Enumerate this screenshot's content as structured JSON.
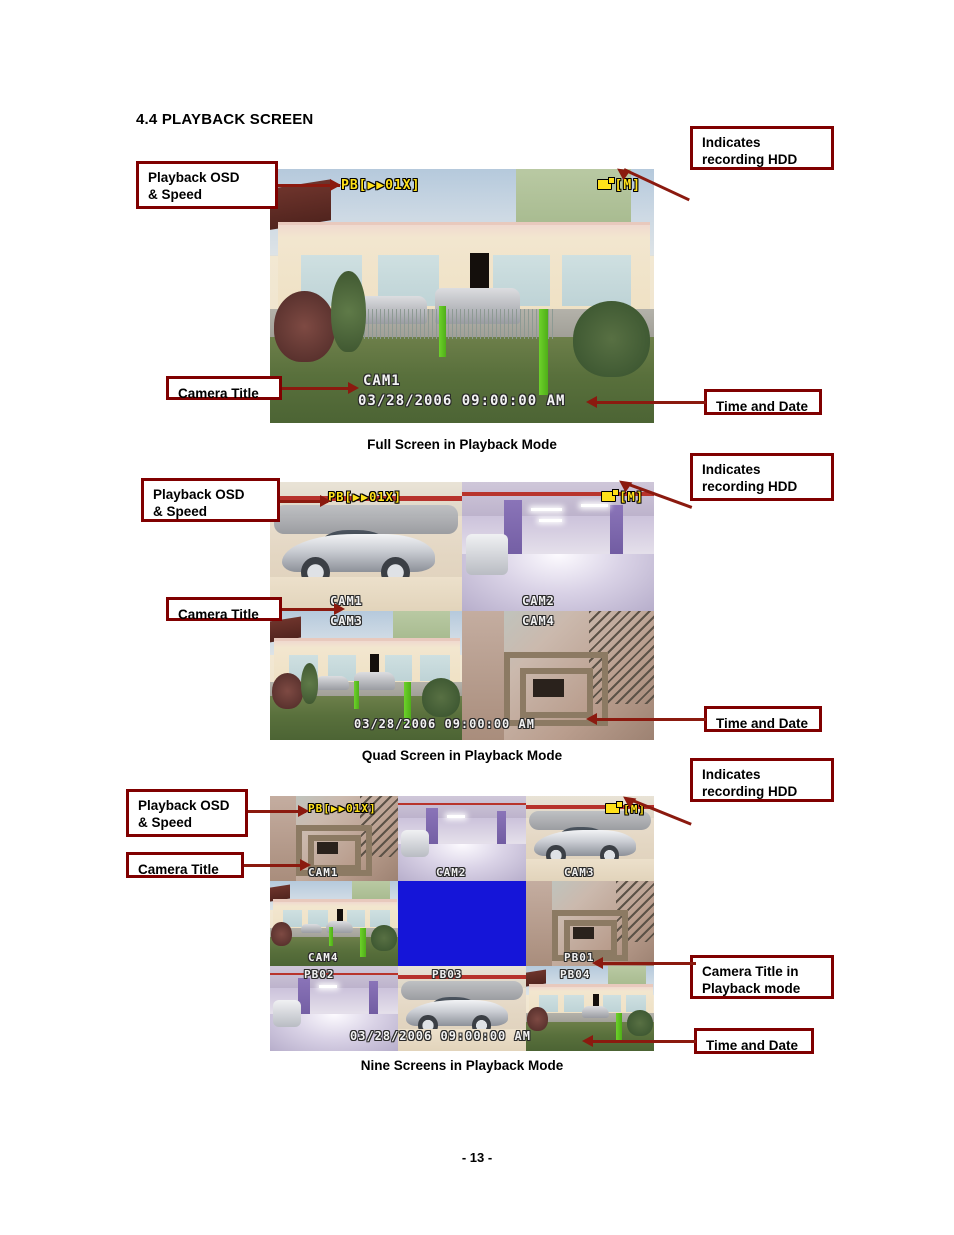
{
  "document": {
    "section_number": "4.4",
    "section_title": "4.4 PLAYBACK SCREEN",
    "page_number": "- 13 -"
  },
  "osd": {
    "playback_speed": "PB[▶▶01X]",
    "hdd_indicator": "[M]",
    "hdd_icon": "hdd-icon",
    "timestamp": "03/28/2006  09:00:00  AM"
  },
  "callouts": {
    "playback_osd_speed": "Playback OSD\n& Speed",
    "camera_title": "Camera Title",
    "indicates_recording_hdd": "Indicates\nrecording HDD",
    "time_and_date": "Time and Date",
    "camera_title_playback": "Camera Title in\nPlayback mode"
  },
  "screens": [
    {
      "id": "full-screen",
      "caption": "Full Screen in Playback Mode",
      "mode": "full",
      "channels": [
        {
          "title": "CAM1",
          "scene": "building"
        }
      ],
      "osd_speed": "PB[▶▶01X]",
      "hdd": "[M]",
      "timestamp": "03/28/2006  09:00:00  AM"
    },
    {
      "id": "quad-screen",
      "caption": "Quad Screen in Playback Mode",
      "mode": "quad",
      "channels": [
        {
          "title": "CAM1",
          "scene": "car"
        },
        {
          "title": "CAM2",
          "scene": "garage"
        },
        {
          "title": "CAM3",
          "scene": "building"
        },
        {
          "title": "CAM4",
          "scene": "stair"
        }
      ],
      "osd_speed": "PB[▶▶01X]",
      "hdd": "[M]",
      "timestamp": "03/28/2006  09:00:00  AM"
    },
    {
      "id": "nine-screen",
      "caption": "Nine Screens in Playback Mode",
      "mode": "nine",
      "channels": [
        {
          "title": "CAM1",
          "scene": "stair"
        },
        {
          "title": "CAM2",
          "scene": "garage"
        },
        {
          "title": "CAM3",
          "scene": "car"
        },
        {
          "title": "CAM4",
          "scene": "building"
        },
        {
          "title": "",
          "scene": "blank"
        },
        {
          "title": "PB01",
          "scene": "stair"
        },
        {
          "title": "PB02",
          "scene": "garage"
        },
        {
          "title": "PB03",
          "scene": "car"
        },
        {
          "title": "PB04",
          "scene": "building"
        }
      ],
      "osd_speed": "PB[▶▶01X]",
      "hdd": "[M]",
      "timestamp": "03/28/2006  09:00:00  AM"
    }
  ],
  "colors": {
    "callout_border": "#800000",
    "leader_line": "#8b1a0f",
    "osd_yellow": "#ffe11a",
    "osd_white": "#f2f2f2",
    "blank_channel": "#1515d8"
  }
}
